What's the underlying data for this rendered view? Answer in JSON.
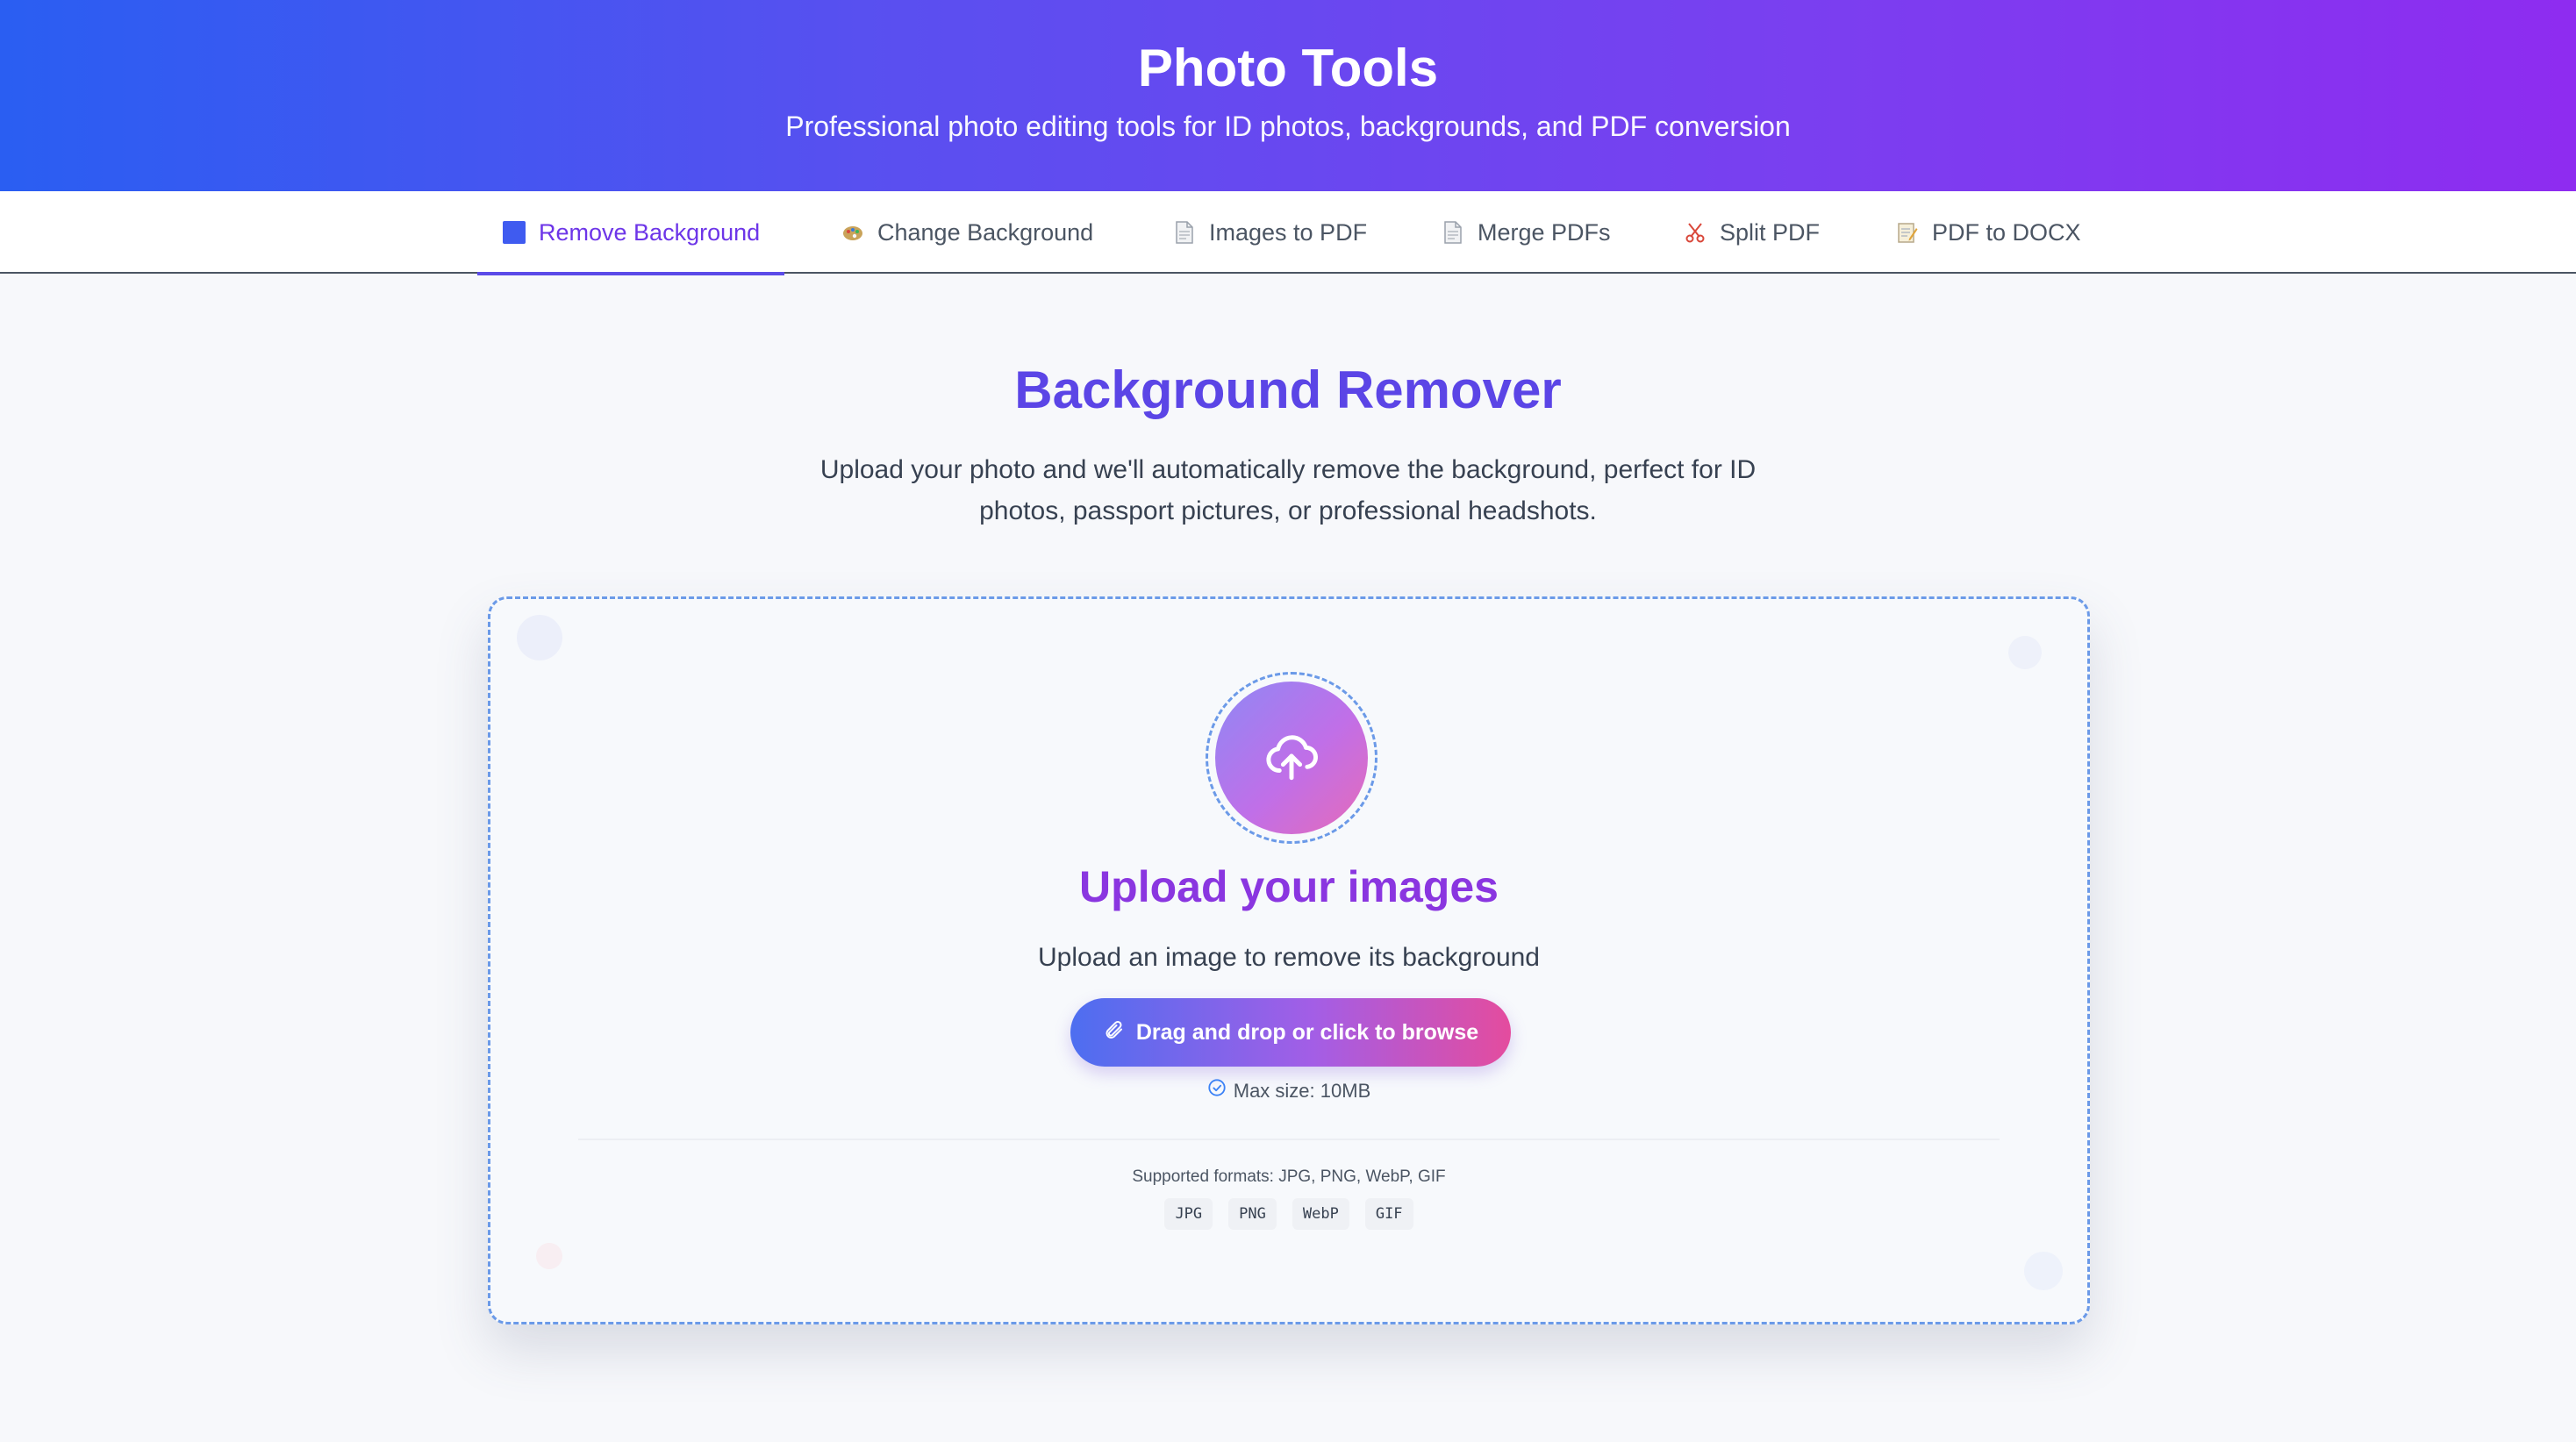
{
  "header": {
    "title": "Photo Tools",
    "subtitle": "Professional photo editing tools for ID photos, backgrounds, and PDF conversion"
  },
  "tabs": [
    {
      "label": "Remove Background",
      "icon": "blue-square-icon",
      "active": true
    },
    {
      "label": "Change Background",
      "icon": "palette-icon",
      "active": false
    },
    {
      "label": "Images to PDF",
      "icon": "document-icon",
      "active": false
    },
    {
      "label": "Merge PDFs",
      "icon": "document-icon",
      "active": false
    },
    {
      "label": "Split PDF",
      "icon": "scissors-icon",
      "active": false
    },
    {
      "label": "PDF to DOCX",
      "icon": "memo-icon",
      "active": false
    }
  ],
  "main": {
    "title": "Background Remover",
    "description": "Upload your photo and we'll automatically remove the background, perfect for ID photos, passport pictures, or professional headshots."
  },
  "upload": {
    "icon": "cloud-upload-icon",
    "title": "Upload your images",
    "description": "Upload an image to remove its background",
    "button_label": "Drag and drop or click to browse",
    "max_size": "Max size: 10MB",
    "formats_label": "Supported formats: JPG, PNG, WebP, GIF",
    "formats": [
      "JPG",
      "PNG",
      "WebP",
      "GIF"
    ]
  },
  "colors": {
    "accent": "#5b45e6",
    "upload_title": "#8a36e0",
    "dashed_border": "#6b9ae8"
  }
}
